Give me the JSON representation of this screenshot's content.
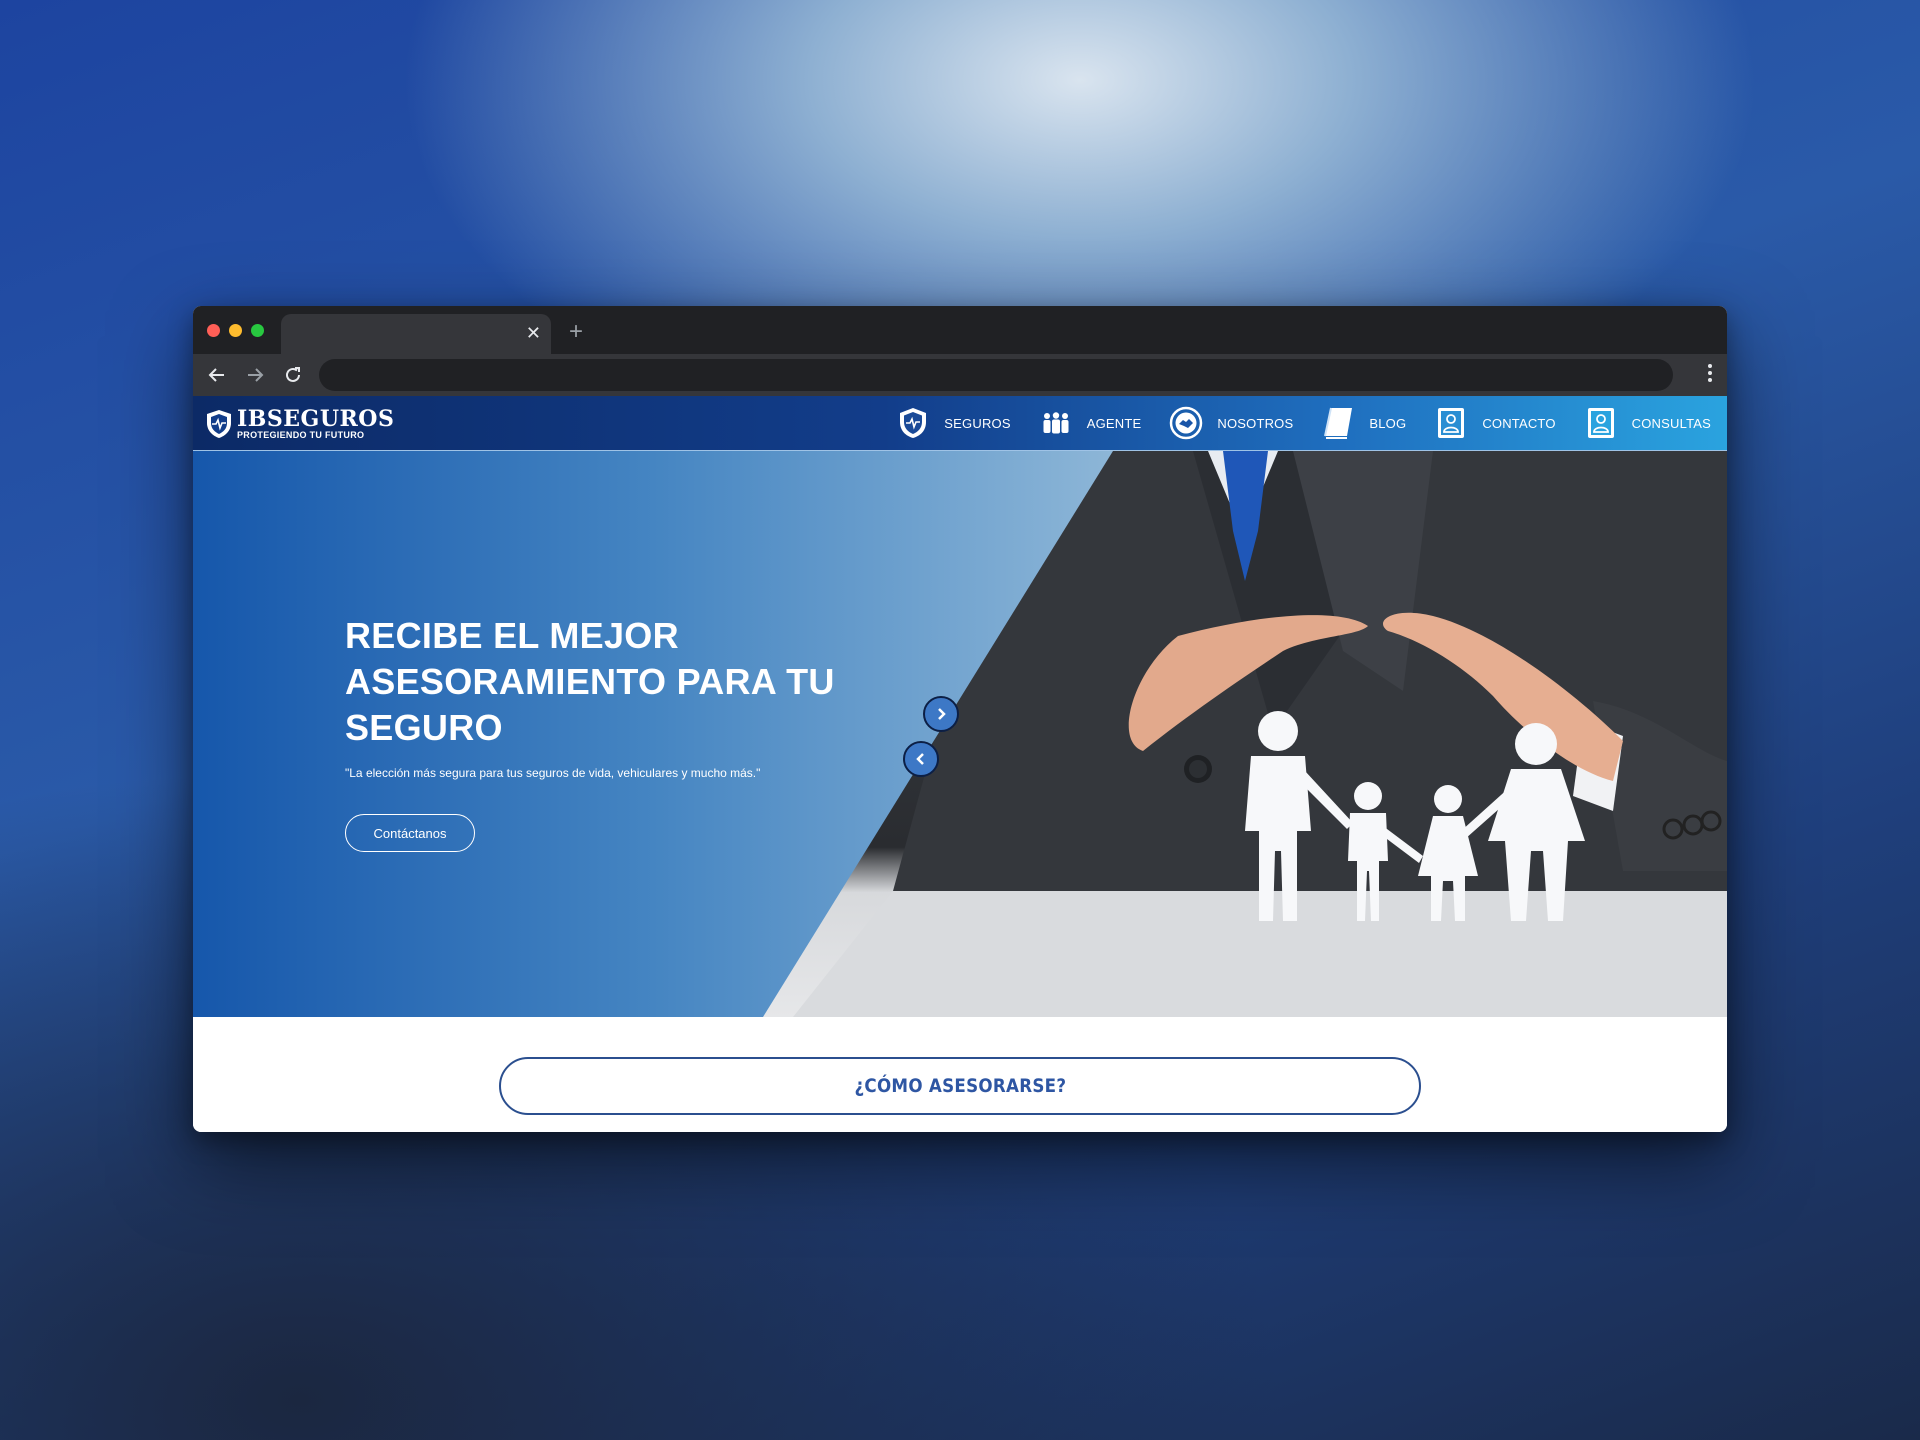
{
  "browser": {
    "tab_close": "✕",
    "new_tab": "+",
    "address_value": ""
  },
  "site": {
    "logo": {
      "name": "IBSEGUROS",
      "tagline": "PROTEGIENDO TU FUTURO"
    },
    "nav": [
      {
        "label": "SEGUROS",
        "icon": "shield-heartbeat-icon"
      },
      {
        "label": "AGENTE",
        "icon": "people-icon"
      },
      {
        "label": "NOSOTROS",
        "icon": "handshake-circle-icon"
      },
      {
        "label": "BLOG",
        "icon": "book-icon"
      },
      {
        "label": "CONTACTO",
        "icon": "contact-card-icon"
      },
      {
        "label": "CONSULTAS",
        "icon": "contact-card-icon"
      }
    ],
    "hero": {
      "title": "RECIBE EL MEJOR ASESORAMIENTO PARA TU SEGURO",
      "subtitle": "\"La elección más segura para tus seguros de vida, vehiculares y mucho más.\"",
      "cta_label": "Contáctanos"
    },
    "section_button": "¿CÓMO ASESORARSE?"
  },
  "colors": {
    "nav_start": "#0c2a66",
    "nav_end": "#2aa3df",
    "hero_blue": "#1f5fae",
    "accent_text": "#2e56a3"
  }
}
